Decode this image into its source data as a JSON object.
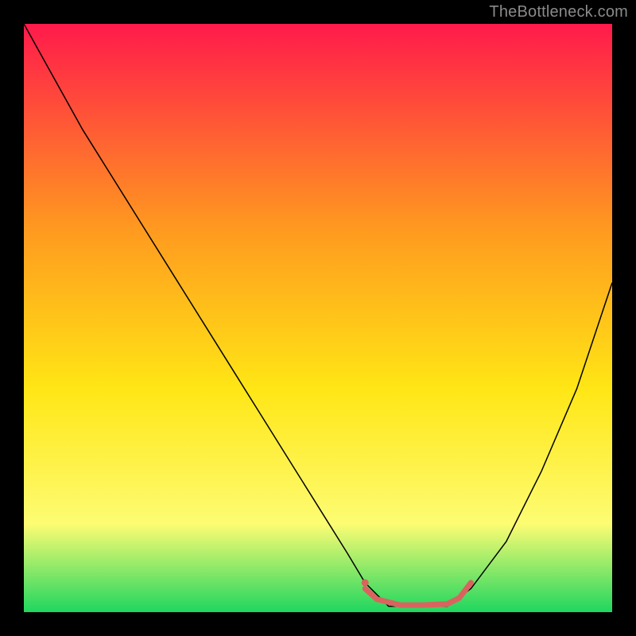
{
  "watermark": "TheBottleneck.com",
  "chart_data": {
    "type": "line",
    "title": "",
    "xlabel": "",
    "ylabel": "",
    "xlim": [
      0,
      100
    ],
    "ylim": [
      0,
      100
    ],
    "background_gradient": {
      "top": "#ff1a4b",
      "mid_upper": "#ff9a1f",
      "mid": "#ffe615",
      "mid_lower": "#fdfc73",
      "bottom": "#1fd65f"
    },
    "series": [
      {
        "name": "bottleneck-curve",
        "color": "#000000",
        "stroke_width": 1.5,
        "x": [
          0,
          5,
          10,
          15,
          20,
          25,
          30,
          35,
          40,
          45,
          50,
          55,
          58,
          62,
          68,
          72,
          76,
          82,
          88,
          94,
          100
        ],
        "values": [
          100,
          91,
          82,
          74,
          66,
          58,
          50,
          42,
          34,
          26,
          18,
          10,
          5,
          1,
          1,
          1,
          4,
          12,
          24,
          38,
          56
        ]
      },
      {
        "name": "optimal-range-marker",
        "color": "#d9645f",
        "stroke_width": 7,
        "linecap": "round",
        "x": [
          58,
          60,
          64,
          68,
          72,
          74,
          76
        ],
        "values": [
          4,
          2.2,
          1.2,
          1.2,
          1.4,
          2.4,
          5
        ]
      }
    ],
    "marker": {
      "name": "optimal-start-dot",
      "color": "#d9645f",
      "x": 58,
      "y": 5,
      "r": 4.5
    }
  }
}
